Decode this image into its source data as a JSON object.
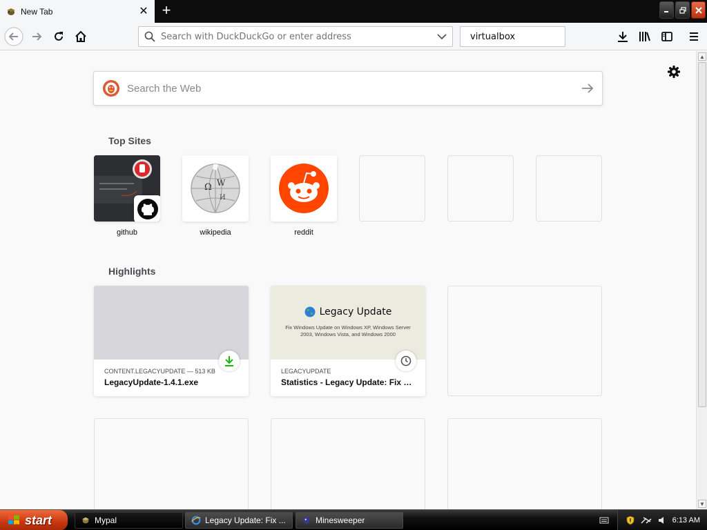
{
  "browser": {
    "tab": {
      "title": "New Tab"
    },
    "url_placeholder": "Search with DuckDuckGo or enter address",
    "search_box": {
      "value": "virtualbox"
    }
  },
  "newtab": {
    "search_placeholder": "Search the Web",
    "top_sites_title": "Top Sites",
    "top_sites": [
      {
        "label": "github"
      },
      {
        "label": "wikipedia"
      },
      {
        "label": "reddit"
      }
    ],
    "highlights_title": "Highlights",
    "highlights": [
      {
        "host": "CONTENT.LEGACYUPDATE — 513 KB",
        "title": "LegacyUpdate-1.4.1.exe"
      },
      {
        "host": "LEGACYUPDATE",
        "title": "Statistics - Legacy Update: Fix W...",
        "preview_title": "Legacy Update",
        "preview_text": "Fix Windows Update on Windows XP, Windows Server 2003, Windows Vista, and Windows 2000"
      }
    ]
  },
  "taskbar": {
    "start_label": "start",
    "items": [
      {
        "label": "Mypal"
      },
      {
        "label": "Legacy Update: Fix ..."
      },
      {
        "label": "Minesweeper"
      }
    ],
    "clock": "6:13 AM"
  },
  "colors": {
    "reddit": "#ff4500",
    "duckduckgo": "#de5833",
    "download_green": "#12bc00",
    "legacy_preview_bg": "#ecebe0"
  }
}
